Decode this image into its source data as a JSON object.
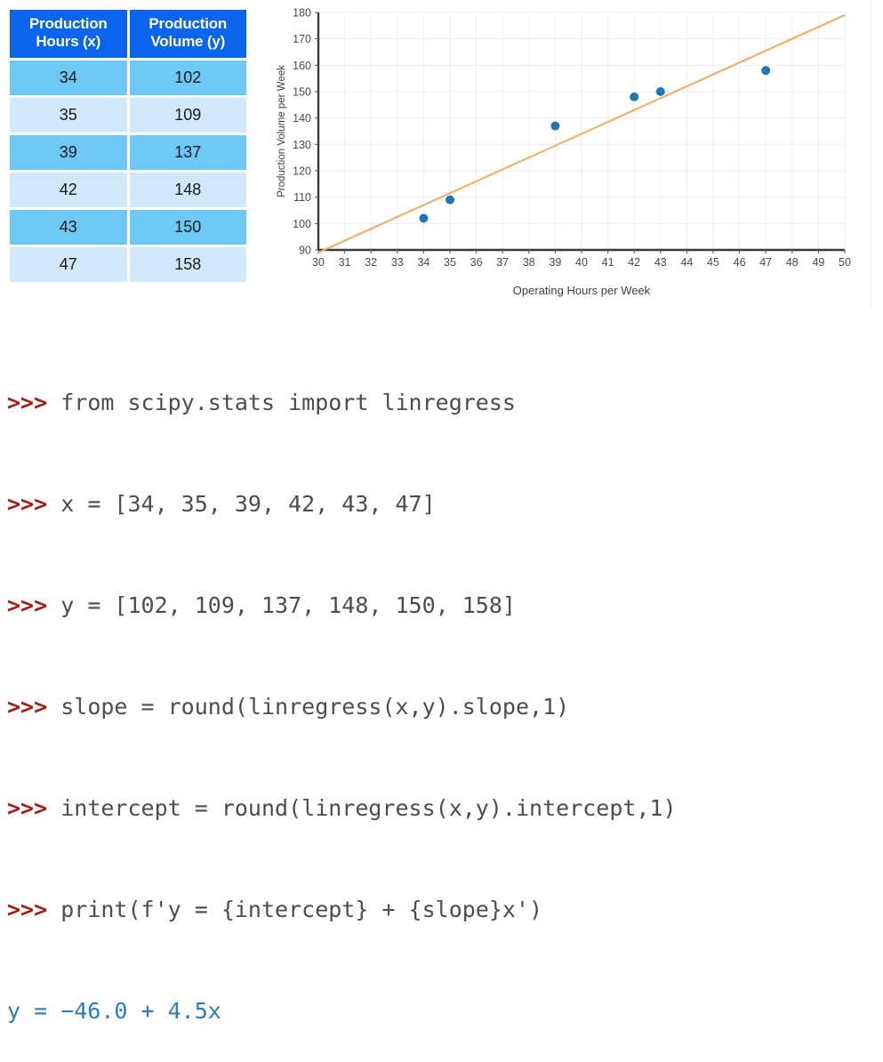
{
  "table": {
    "headers": [
      "Production Hours (x)",
      "Production Volume (y)"
    ],
    "header_lines": [
      [
        "Production",
        "Hours (x)"
      ],
      [
        "Production",
        "Volume (y)"
      ]
    ],
    "rows": [
      [
        "34",
        "102"
      ],
      [
        "35",
        "109"
      ],
      [
        "39",
        "137"
      ],
      [
        "42",
        "148"
      ],
      [
        "43",
        "150"
      ],
      [
        "47",
        "158"
      ]
    ],
    "colors": {
      "header_bg": "#0a64ee",
      "header_text": "#ffffff",
      "row_odd_bg": "#6ec8f5",
      "row_even_bg": "#cfe8fa"
    }
  },
  "chart_data": {
    "type": "scatter",
    "title": "",
    "xlabel": "Operating Hours per Week",
    "ylabel": "Production Volume per Week",
    "xlim": [
      30,
      50
    ],
    "ylim": [
      90,
      180
    ],
    "xticks": [
      30,
      31,
      32,
      33,
      34,
      35,
      36,
      37,
      38,
      39,
      40,
      41,
      42,
      43,
      44,
      45,
      46,
      47,
      48,
      49,
      50
    ],
    "yticks": [
      90,
      100,
      110,
      120,
      130,
      140,
      150,
      160,
      170,
      180
    ],
    "xtick_labels": [
      "30",
      "31",
      "32",
      "33",
      "34",
      "35",
      "36",
      "37",
      "38",
      "39",
      "40",
      "41",
      "42",
      "43",
      "44",
      "45",
      "46",
      "47",
      "48",
      "49",
      "50"
    ],
    "ytick_labels": [
      "90",
      "100",
      "110",
      "120",
      "130",
      "140",
      "150",
      "160",
      "170",
      "180"
    ],
    "grid": true,
    "legend": "none",
    "series": [
      {
        "name": "observations",
        "type": "scatter",
        "color": "#1f77b4",
        "x": [
          34,
          35,
          39,
          42,
          43,
          47
        ],
        "y": [
          102,
          109,
          137,
          148,
          150,
          158
        ]
      },
      {
        "name": "regression line",
        "type": "line",
        "color": "#f5ab61",
        "equation": "y = -46.0 + 4.5x",
        "slope": 4.5,
        "intercept": -46.0,
        "x": [
          30,
          50
        ],
        "y": [
          89,
          179
        ]
      }
    ]
  },
  "console": {
    "prompt": ">>>",
    "lines": [
      {
        "prompt": ">>>",
        "code": "from scipy.stats import linregress"
      },
      {
        "prompt": ">>>",
        "code": "x = [34, 35, 39, 42, 43, 47]"
      },
      {
        "prompt": ">>>",
        "code": "y = [102, 109, 137, 148, 150, 158]"
      },
      {
        "prompt": ">>>",
        "code": "slope = round(linregress(x,y).slope,1)"
      },
      {
        "prompt": ">>>",
        "code": "intercept = round(linregress(x,y).intercept,1)"
      },
      {
        "prompt": ">>>",
        "code": "print(f'y = {intercept} + {slope}x')"
      }
    ],
    "output": "y = −46.0 + 4.5x",
    "colors": {
      "prompt": "#a61b12",
      "code": "#4d4d4d",
      "output": "#2a7bc4"
    }
  }
}
